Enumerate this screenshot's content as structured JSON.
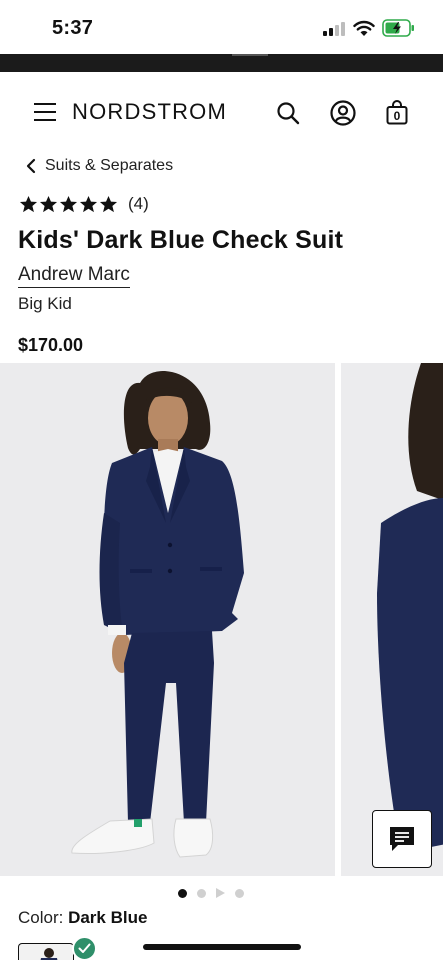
{
  "status_bar": {
    "time": "5:37"
  },
  "header": {
    "brand": "NORDSTROM",
    "bag_count": "0"
  },
  "breadcrumb": {
    "label": "Suits & Separates"
  },
  "product": {
    "rating_count": "(4)",
    "title": "Kids' Dark Blue Check Suit",
    "brand": "Andrew Marc",
    "size_group": "Big Kid",
    "price": "$170.00"
  },
  "gallery": {
    "images": 2,
    "active_index": 0
  },
  "color": {
    "label": "Color: ",
    "value": "Dark Blue"
  },
  "colors": {
    "accent_green": "#2f8f6a",
    "suit_navy": "#1f2a55"
  }
}
